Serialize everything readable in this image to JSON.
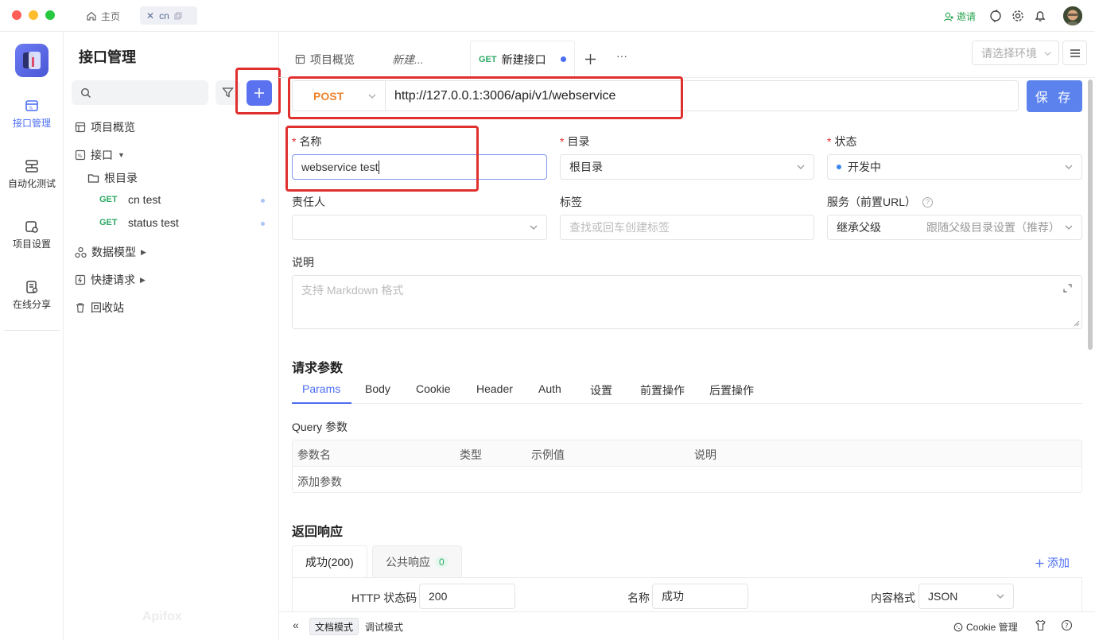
{
  "titlebar": {
    "home_tab": "主页",
    "window_tab": "cn",
    "invite_label": "邀请"
  },
  "leftnav": {
    "items": [
      {
        "label": "接口管理"
      },
      {
        "label": "自动化测试"
      },
      {
        "label": "项目设置"
      },
      {
        "label": "在线分享"
      }
    ]
  },
  "sidebar": {
    "title": "接口管理",
    "search_placeholder": "",
    "tree": {
      "overview": "项目概览",
      "api_group": "接口",
      "root_folder": "根目录",
      "apis": [
        {
          "method": "GET",
          "name": "cn test"
        },
        {
          "method": "GET",
          "name": "status test"
        }
      ],
      "data_models": "数据模型",
      "quick_requests": "快捷请求",
      "trash": "回收站"
    },
    "watermark": "Apifox"
  },
  "tabs": {
    "overview": "项目概览",
    "draft": "新建...",
    "active_method": "GET",
    "active_label": "新建接口",
    "more": "···",
    "env_placeholder": "请选择环境"
  },
  "request": {
    "method": "POST",
    "url": "http://127.0.0.1:3006/api/v1/webservice",
    "save_label": "保 存"
  },
  "form": {
    "name_label": "名称",
    "name_value": "webservice test",
    "folder_label": "目录",
    "folder_value": "根目录",
    "status_label": "状态",
    "status_value": "开发中",
    "owner_label": "责任人",
    "tags_label": "标签",
    "tags_placeholder": "查找或回车创建标签",
    "service_label": "服务（前置URL）",
    "service_value": "继承父级",
    "service_hint": "跟随父级目录设置（推荐）",
    "desc_label": "说明",
    "desc_placeholder": "支持 Markdown 格式"
  },
  "params": {
    "section_title": "请求参数",
    "tabs": [
      "Params",
      "Body",
      "Cookie",
      "Header",
      "Auth",
      "设置",
      "前置操作",
      "后置操作"
    ],
    "query_title": "Query 参数",
    "columns": [
      "参数名",
      "类型",
      "示例值",
      "说明"
    ],
    "add_placeholder": "添加参数"
  },
  "response": {
    "section_title": "返回响应",
    "tab_success": "成功(200)",
    "tab_common": "公共响应",
    "common_count": "0",
    "add_label": "添加",
    "http_code_label": "HTTP 状态码",
    "http_code_value": "200",
    "name_label": "名称",
    "name_value": "成功",
    "content_type_label": "内容格式",
    "content_type_value": "JSON"
  },
  "bottombar": {
    "doc_mode": "文档模式",
    "debug_mode": "调试模式",
    "cookie_manage": "Cookie 管理"
  },
  "colors": {
    "accent": "#4c6ef5",
    "save_button": "#5b82ed",
    "method_post": "#f0832c",
    "method_get": "#2ca864",
    "highlight_box": "#e0302e"
  }
}
